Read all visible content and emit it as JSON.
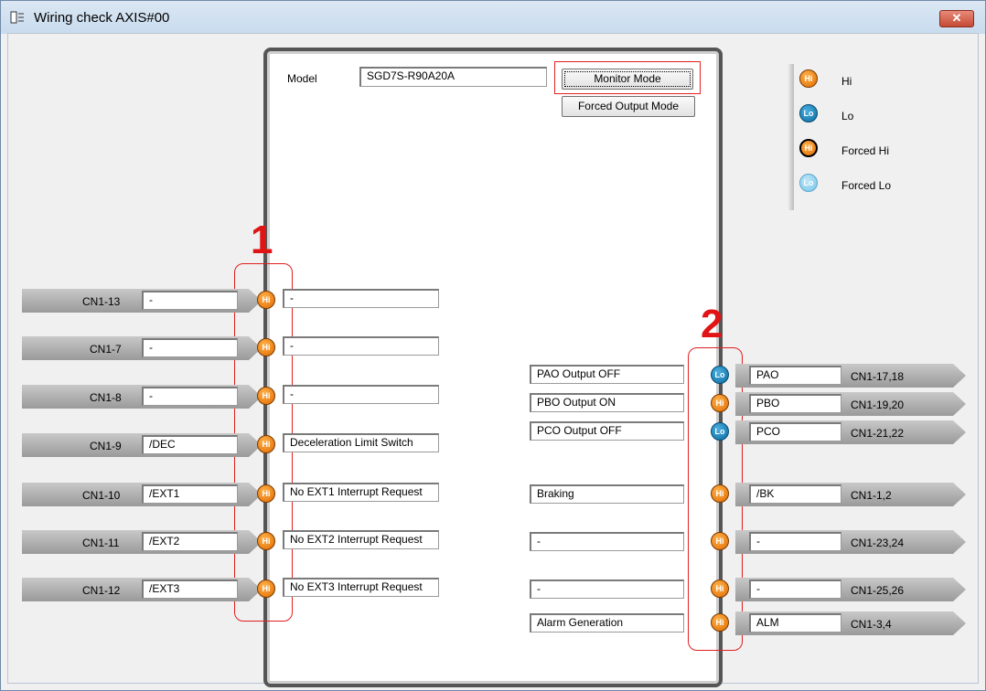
{
  "window": {
    "title": "Wiring check AXIS#00",
    "close_label": "✕"
  },
  "model": {
    "label": "Model",
    "value": "SGD7S-R90A20A"
  },
  "buttons": {
    "monitor_mode": "Monitor Mode",
    "forced_output_mode": "Forced Output Mode"
  },
  "legend": [
    {
      "state": "Hi",
      "label": "Hi"
    },
    {
      "state": "Lo",
      "label": "Lo"
    },
    {
      "state": "Hi",
      "label": "Forced Hi"
    },
    {
      "state": "Lo",
      "label": "Forced Lo"
    }
  ],
  "annotations": {
    "inputs_marker": "1",
    "outputs_marker": "2"
  },
  "inputs": [
    {
      "pin": "CN1-13",
      "signal": "-",
      "state": "Hi",
      "description": "-"
    },
    {
      "pin": "CN1-7",
      "signal": "-",
      "state": "Hi",
      "description": "-"
    },
    {
      "pin": "CN1-8",
      "signal": "-",
      "state": "Hi",
      "description": "-"
    },
    {
      "pin": "CN1-9",
      "signal": "/DEC",
      "state": "Hi",
      "description": "Deceleration Limit Switch"
    },
    {
      "pin": "CN1-10",
      "signal": "/EXT1",
      "state": "Hi",
      "description": "No EXT1 Interrupt Request"
    },
    {
      "pin": "CN1-11",
      "signal": "/EXT2",
      "state": "Hi",
      "description": "No EXT2 Interrupt Request"
    },
    {
      "pin": "CN1-12",
      "signal": "/EXT3",
      "state": "Hi",
      "description": "No EXT3 Interrupt Request"
    }
  ],
  "outputs": [
    {
      "description": "PAO Output OFF",
      "state": "Lo",
      "signal": "PAO",
      "pin": "CN1-17,18"
    },
    {
      "description": "PBO Output ON",
      "state": "Hi",
      "signal": "PBO",
      "pin": "CN1-19,20"
    },
    {
      "description": "PCO Output OFF",
      "state": "Lo",
      "signal": "PCO",
      "pin": "CN1-21,22"
    },
    {
      "description": "Braking",
      "state": "Hi",
      "signal": "/BK",
      "pin": "CN1-1,2"
    },
    {
      "description": "-",
      "state": "Hi",
      "signal": "-",
      "pin": "CN1-23,24"
    },
    {
      "description": "-",
      "state": "Hi",
      "signal": "-",
      "pin": "CN1-25,26"
    },
    {
      "description": "Alarm Generation",
      "state": "Hi",
      "signal": "ALM",
      "pin": "CN1-3,4"
    }
  ],
  "colors": {
    "hi": "#e06a00",
    "lo": "#0a6aa0",
    "annotation": "#e01414"
  }
}
